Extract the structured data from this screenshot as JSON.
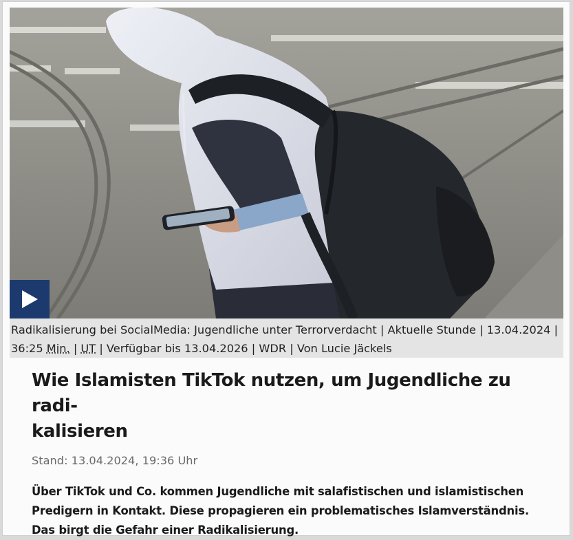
{
  "media": {
    "image_alt": "Jugendlicher mit Kapuzenpullover und Rucksack schaut auf sein Smartphone",
    "play_icon": "play-icon",
    "accent_color": "#1c3a6e"
  },
  "caption": {
    "text_part1": "Radikalisierung bei SocialMedia: Jugendliche unter Terrorverdacht | Aktuelle Stunde | 13.04.2024 | 36:25 ",
    "min_label": "Min.",
    "sep1": " | ",
    "ut_label": "UT",
    "text_part2": " | Verfügbar bis 13.04.2026 | WDR | Von Lucie Jäckels"
  },
  "article": {
    "headline_line1": "Wie Islamisten TikTok nutzen, um Jugendliche zu radi-",
    "headline_line2": "kalisieren",
    "stand": "Stand: 13.04.2024, 19:36 Uhr",
    "lead_line1": "Über TikTok und Co. kommen Jugendliche mit salafistischen und islamistischen",
    "lead_line2": "Predigern in Kontakt. Diese propagieren ein problematisches Islamverständnis.",
    "lead_line3": "Das birgt die Gefahr einer Radikalisierung."
  }
}
